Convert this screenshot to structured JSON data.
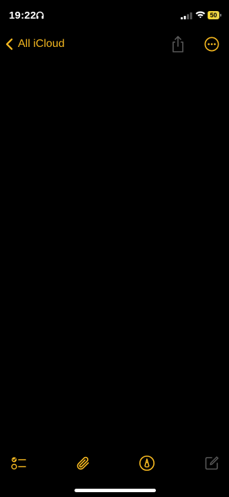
{
  "status_bar": {
    "time": "19:22",
    "battery_level": "50",
    "battery_fraction": 0.5,
    "icons": [
      "headphones-icon",
      "cellular-signal-icon",
      "wifi-icon",
      "battery-icon"
    ]
  },
  "nav": {
    "back_label": "All iCloud",
    "back_icon": "chevron-left-icon",
    "share_icon": "share-icon",
    "more_icon": "more-ellipsis-icon"
  },
  "note": {
    "body": ""
  },
  "toolbar": {
    "checklist_icon": "checklist-icon",
    "attachment_icon": "paperclip-icon",
    "markup_icon": "markup-pen-icon",
    "compose_icon": "compose-icon"
  },
  "colors": {
    "background": "#000000",
    "accent": "#f5b820",
    "disabled": "#5a5a5a",
    "battery": "#f2d535"
  }
}
